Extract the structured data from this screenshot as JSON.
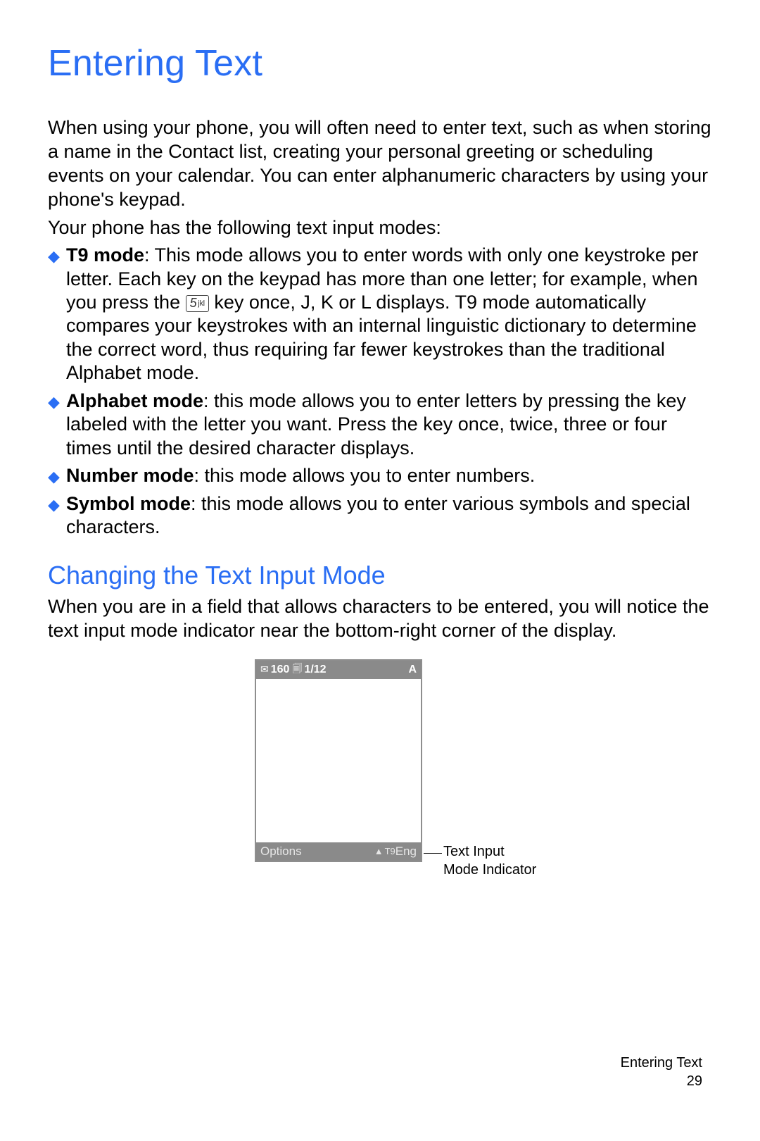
{
  "title": "Entering Text",
  "intro_p1": "When using your phone, you will often need to enter text, such as when storing a name in the Contact list, creating your personal greeting or scheduling events on your calendar. You can enter alphanumeric characters by using your phone's keypad.",
  "intro_p2": "Your phone has the following text input modes:",
  "bullets": {
    "t9": {
      "label": "T9 mode",
      "text_a": ": This mode allows you to enter words with only one keystroke per letter. Each key on the keypad has more than one letter; for example, when you press the ",
      "key_num": "5",
      "key_letters": "jkl",
      "text_b": " key once, J, K or L displays. T9 mode automatically compares your keystrokes with an internal linguistic dictionary to determine the correct word, thus requiring far fewer keystrokes than the traditional Alphabet mode."
    },
    "alphabet": {
      "label": "Alphabet mode",
      "text": ": this mode allows you to enter letters by pressing the key labeled with the letter you want. Press the key once, twice, three or four times until the desired character displays."
    },
    "number": {
      "label": "Number mode",
      "text": ": this mode allows you to enter numbers."
    },
    "symbol": {
      "label": "Symbol mode",
      "text": ": this mode allows you to enter various symbols and special characters."
    }
  },
  "subheading": "Changing the Text Input Mode",
  "sub_p": "When you are in a field that allows characters to be entered, you will notice the text input mode indicator near the bottom-right corner of the display.",
  "phone": {
    "top_count": "160",
    "top_page": "1/12",
    "top_right": "A",
    "bottom_left": "Options",
    "bottom_t9_prefix": "T9",
    "bottom_lang": "Eng"
  },
  "callout_l1": "Text Input",
  "callout_l2": "Mode Indicator",
  "footer_section": "Entering Text",
  "footer_page": "29"
}
